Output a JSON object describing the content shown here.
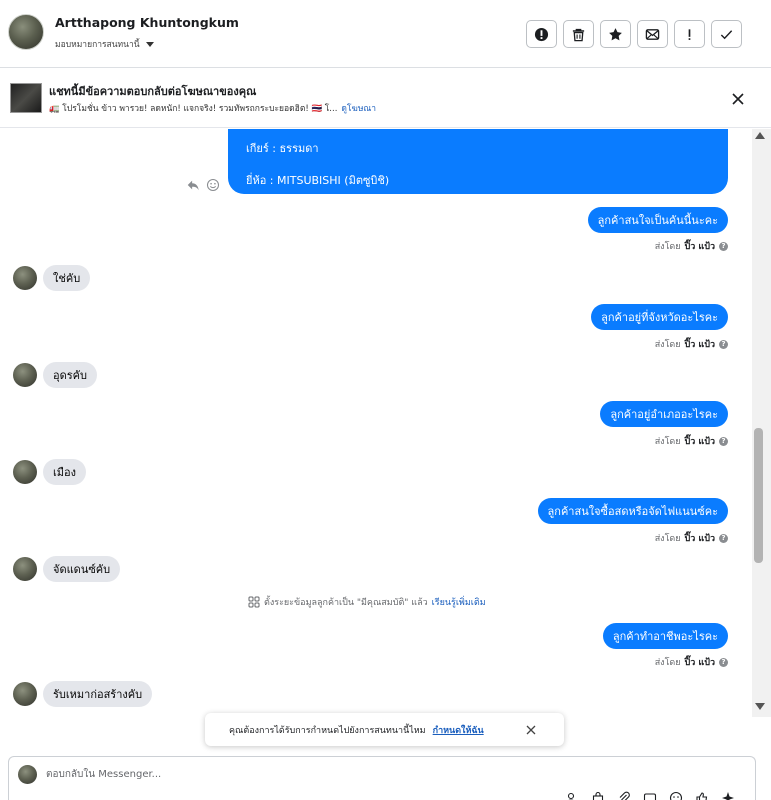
{
  "header": {
    "name": "Artthapong Khuntongkum",
    "subtitle": "มอบหมายการสนทนานี้",
    "actions": [
      "report-icon",
      "trash-icon",
      "star-icon",
      "mark-unread-icon",
      "spam-icon",
      "done-icon"
    ]
  },
  "ad": {
    "title": "แชทนี้มีข้อความตอบกลับต่อโฆษณาของคุณ",
    "description": "🚛 โปรโมชั่น ข้าว พารวย! ลดหนัก! แจกจริง! รวมทัพรถกระบะยอดฮิต! 🇹🇭 โ...",
    "link": "ดูโฆษณา"
  },
  "messages": {
    "big_line1": "เกียร์ : ธรรมดา",
    "big_line2": "ยี่ห้อ : MITSUBISHI (มิตซูบิชิ)",
    "out1": "ลูกค้าสนใจเป็นคันนี้นะคะ",
    "in1": "ใช่คับ",
    "out2": "ลูกค้าอยู่ที่จังหวัดอะไรคะ",
    "in2": "อุดรคับ",
    "out3": "ลูกค้าอยู่อำเภออะไรคะ",
    "in3": "เมือง",
    "out4": "ลูกค้าสนใจซื้อสดหรือจัดไฟแนนซ์คะ",
    "in4": "จัดแดนซ์คับ",
    "out5": "ลูกค้าทำอาชีพอะไรคะ",
    "in5": "รับเหมาก่อสร้างคับ",
    "sent_prefix": "ส่งโดย",
    "sent_by": "ปิ๊ว แป้ว",
    "system": "ตั้งระยะข้อมูลลูกค้าเป็น \"มีคุณสมบัติ\" แล้ว",
    "system_link": "เรียนรู้เพิ่มเติม"
  },
  "notice": {
    "text": "คุณต้องการได้รับการกำหนดไปยังการสนทนานี้ไหม",
    "link": "กำหนดให้ฉัน"
  },
  "composer": {
    "placeholder": "ตอบกลับใน Messenger..."
  },
  "colors": {
    "outgoing": "#0a7cff",
    "incoming": "#e4e6eb",
    "link": "#1a5ebd"
  }
}
